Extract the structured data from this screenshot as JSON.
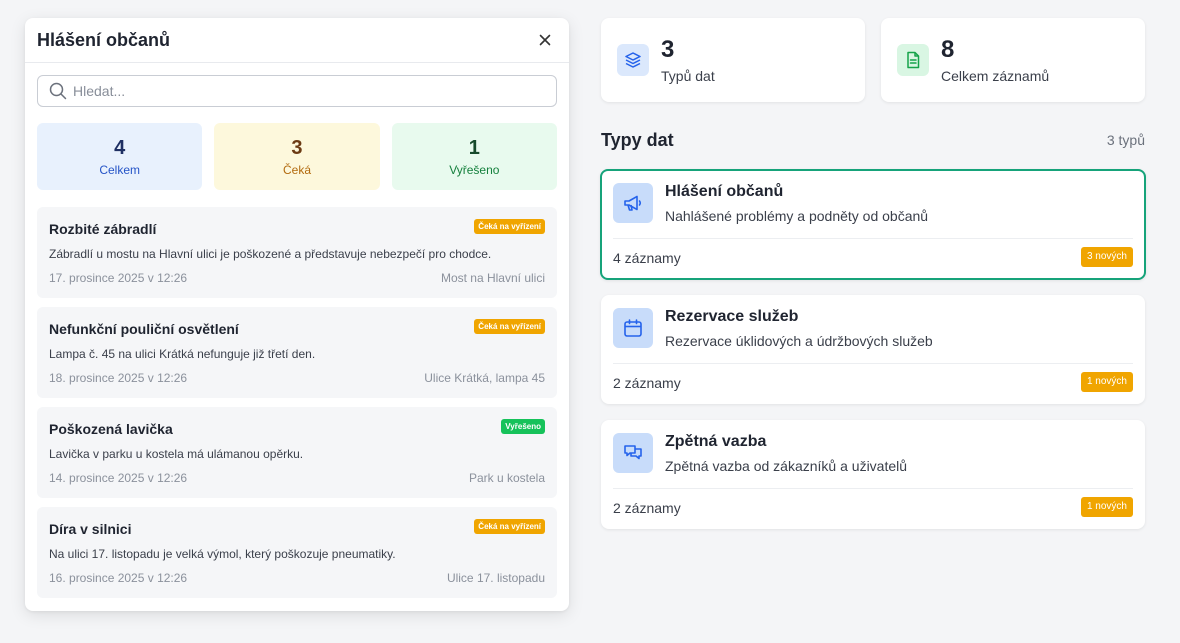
{
  "panel": {
    "title": "Hlášení občanů",
    "search_placeholder": "Hledat...",
    "stats": [
      {
        "value": "4",
        "label": "Celkem"
      },
      {
        "value": "3",
        "label": "Čeká"
      },
      {
        "value": "1",
        "label": "Vyřešeno"
      }
    ],
    "items": [
      {
        "title": "Rozbité zábradlí",
        "badge": "Čeká na vyřízení",
        "desc": "Zábradlí u mostu na Hlavní ulici je poškozené a představuje nebezpečí pro chodce.",
        "date": "17. prosince 2025 v 12:26",
        "location": "Most na Hlavní ulici"
      },
      {
        "title": "Nefunkční pouliční osvětlení",
        "badge": "Čeká na vyřízení",
        "desc": "Lampa č. 45 na ulici Krátká nefunguje již třetí den.",
        "date": "18. prosince 2025 v 12:26",
        "location": "Ulice Krátká, lampa 45"
      },
      {
        "title": "Poškozená lavička",
        "badge": "Vyřešeno",
        "desc": "Lavička v parku u kostela má ulámanou opěrku.",
        "date": "14. prosince 2025 v 12:26",
        "location": "Park u kostela"
      },
      {
        "title": "Díra v silnici",
        "badge": "Čeká na vyřízení",
        "desc": "Na ulici 17. listopadu je velká výmol, který poškozuje pneumatiky.",
        "date": "16. prosince 2025 v 12:26",
        "location": "Ulice 17. listopadu"
      }
    ]
  },
  "summary": {
    "types": {
      "value": "3",
      "label": "Typů dat"
    },
    "records": {
      "value": "8",
      "label": "Celkem záznamů"
    }
  },
  "section": {
    "title": "Typy dat",
    "count": "3 typů"
  },
  "types": [
    {
      "title": "Hlášení občanů",
      "desc": "Nahlášené problémy a podněty od občanů",
      "count": "4 záznamy",
      "new": "3 nových",
      "icon": "megaphone-icon"
    },
    {
      "title": "Rezervace služeb",
      "desc": "Rezervace úklidových a údržbových služeb",
      "count": "2 záznamy",
      "new": "1 nových",
      "icon": "calendar-icon"
    },
    {
      "title": "Zpětná vazba",
      "desc": "Zpětná vazba od zákazníků a uživatelů",
      "count": "2 záznamy",
      "new": "1 nových",
      "icon": "chat-icon"
    }
  ],
  "colors": {
    "accent": "#16a37a",
    "pending": "#f0a500",
    "resolved": "#16c25a",
    "icon_blue": "#2563eb"
  }
}
